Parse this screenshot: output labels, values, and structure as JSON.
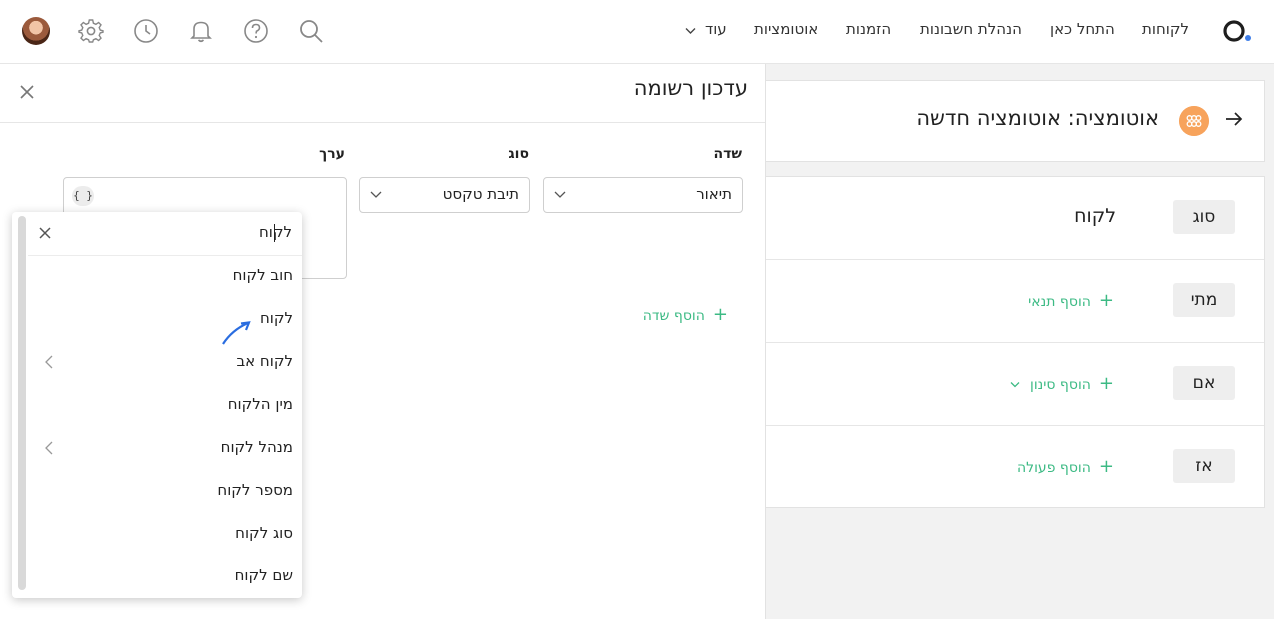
{
  "colors": {
    "accent": "#3cba84",
    "automation_icon": "#f7a35c",
    "pointer": "#2a6de0"
  },
  "topbar": {
    "nav": {
      "customers": "לקוחות",
      "start_here": "התחל כאן",
      "bookkeeping": "הנהלת חשבונות",
      "orders": "הזמנות",
      "automations": "אוטומציות",
      "more": "עוד"
    },
    "icons": [
      "search-icon",
      "help-icon",
      "bell-icon",
      "clock-icon",
      "gear-icon"
    ]
  },
  "automation": {
    "title": "אוטומציה: אוטומציה חדשה",
    "rows": [
      {
        "chip": "סוג",
        "value": "לקוח"
      },
      {
        "chip": "מתי",
        "action": "הוסף תנאי"
      },
      {
        "chip": "אם",
        "action": "הוסף סינון"
      },
      {
        "chip": "אז",
        "action": "הוסף פעולה"
      }
    ]
  },
  "panel": {
    "title": "עדכון רשומה",
    "columns": {
      "field": "שדה",
      "type": "סוג",
      "value": "ערך"
    },
    "field_select": "תיאור",
    "type_select": "תיבת טקסט",
    "braces": "{ }",
    "add_field": "הוסף שדה"
  },
  "dropdown": {
    "search_value": "לקוח",
    "items": [
      {
        "label": "חוב לקוח",
        "submenu": false
      },
      {
        "label": "לקוח",
        "submenu": false
      },
      {
        "label": "לקוח אב",
        "submenu": true
      },
      {
        "label": "מין הלקוח",
        "submenu": false
      },
      {
        "label": "מנהל לקוח",
        "submenu": true
      },
      {
        "label": "מספר לקוח",
        "submenu": false
      },
      {
        "label": "סוג לקוח",
        "submenu": false
      },
      {
        "label": "שם לקוח",
        "submenu": false
      }
    ]
  }
}
